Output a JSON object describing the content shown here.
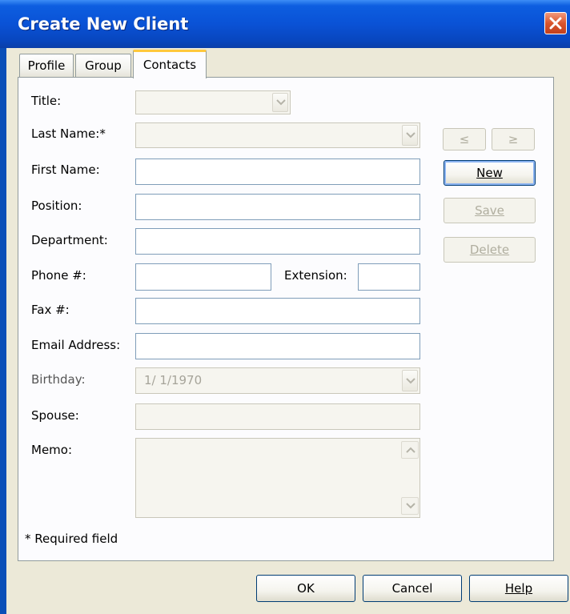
{
  "window": {
    "title": "Create New Client"
  },
  "tabs": [
    {
      "label": "Profile"
    },
    {
      "label": "Group"
    },
    {
      "label": "Contacts"
    }
  ],
  "form": {
    "title_label": "Title:",
    "last_name_label": "Last Name:*",
    "first_name_label": "First Name:",
    "position_label": "Position:",
    "department_label": "Department:",
    "phone_label": "Phone #:",
    "extension_label": "Extension:",
    "fax_label": "Fax #:",
    "email_label": "Email Address:",
    "birthday_label": "Birthday:",
    "birthday_value": "1/ 1/1970",
    "spouse_label": "Spouse:",
    "memo_label": "Memo:",
    "required_note": "* Required field"
  },
  "side_buttons": {
    "prev": "≤",
    "next": "≥",
    "new": "New",
    "save": "Save",
    "delete": "Delete"
  },
  "footer": {
    "ok": "OK",
    "cancel": "Cancel",
    "help": "Help"
  },
  "icons": {
    "close": "close-icon",
    "dropdown": "chevron-down-icon",
    "scroll_up": "chevron-up-icon",
    "scroll_down": "chevron-down-icon"
  }
}
